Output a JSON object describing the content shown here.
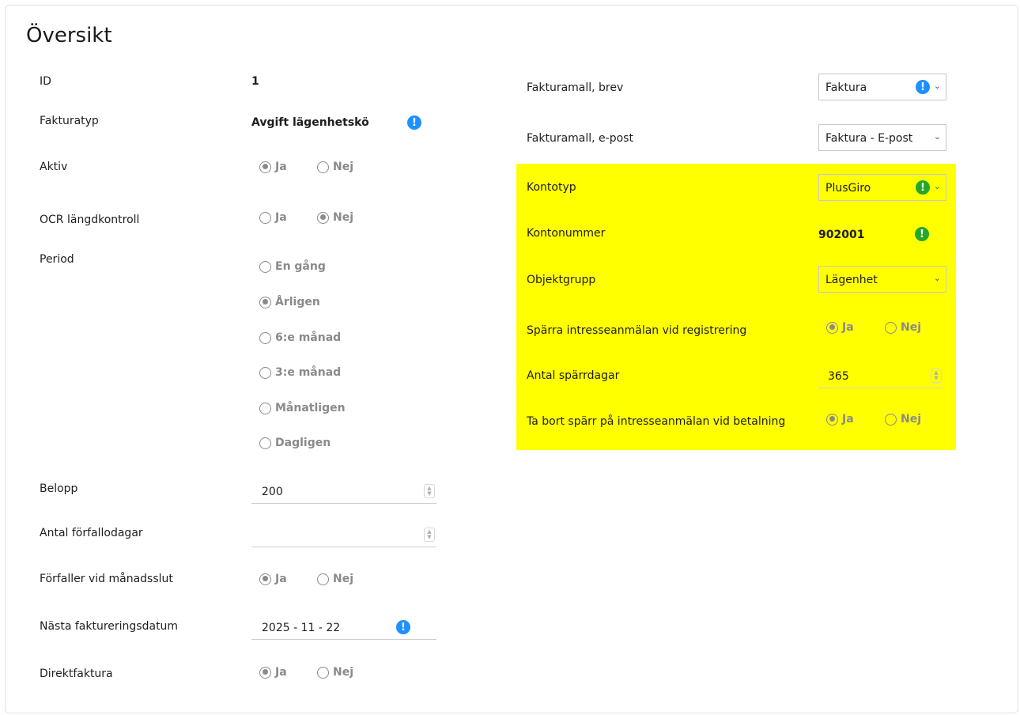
{
  "title": "Översikt",
  "left": {
    "id_label": "ID",
    "id_value": "1",
    "fakturatyp_label": "Fakturatyp",
    "fakturatyp_value": "Avgift lägenhetskö",
    "aktiv_label": "Aktiv",
    "ocr_label": "OCR längdkontroll",
    "period_label": "Period",
    "period_options": [
      "En gång",
      "Årligen",
      "6:e månad",
      "3:e månad",
      "Månatligen",
      "Dagligen"
    ],
    "belopp_label": "Belopp",
    "belopp_value": "200",
    "forfallodagar_label": "Antal förfallodagar",
    "forfallodagar_value": "",
    "manadsslut_label": "Förfaller vid månadsslut",
    "nasta_label": "Nästa faktureringsdatum",
    "nasta_value": "2025 - 11 - 22",
    "direktfaktura_label": "Direktfaktura"
  },
  "right": {
    "brev_label": "Fakturamall, brev",
    "brev_value": "Faktura",
    "epost_label": "Fakturamall, e-post",
    "epost_value": "Faktura - E-post",
    "kontotyp_label": "Kontotyp",
    "kontotyp_value": "PlusGiro",
    "kontonummer_label": "Kontonummer",
    "kontonummer_value": "902001",
    "objektgrupp_label": "Objektgrupp",
    "objektgrupp_value": "Lägenhet",
    "sparra_label": "Spärra intresseanmälan vid registrering",
    "sparrdagar_label": "Antal spärrdagar",
    "sparrdagar_value": "365",
    "tabort_label": "Ta bort spärr på intresseanmälan vid betalning"
  },
  "radio": {
    "yes": "Ja",
    "no": "Nej"
  },
  "icons": {
    "info": "!",
    "chevron": "⌄",
    "spin_up": "▲",
    "spin_down": "▼"
  },
  "colors": {
    "highlight": "#ffff00",
    "info_blue": "#1e90ff",
    "info_green": "#25a82a"
  }
}
